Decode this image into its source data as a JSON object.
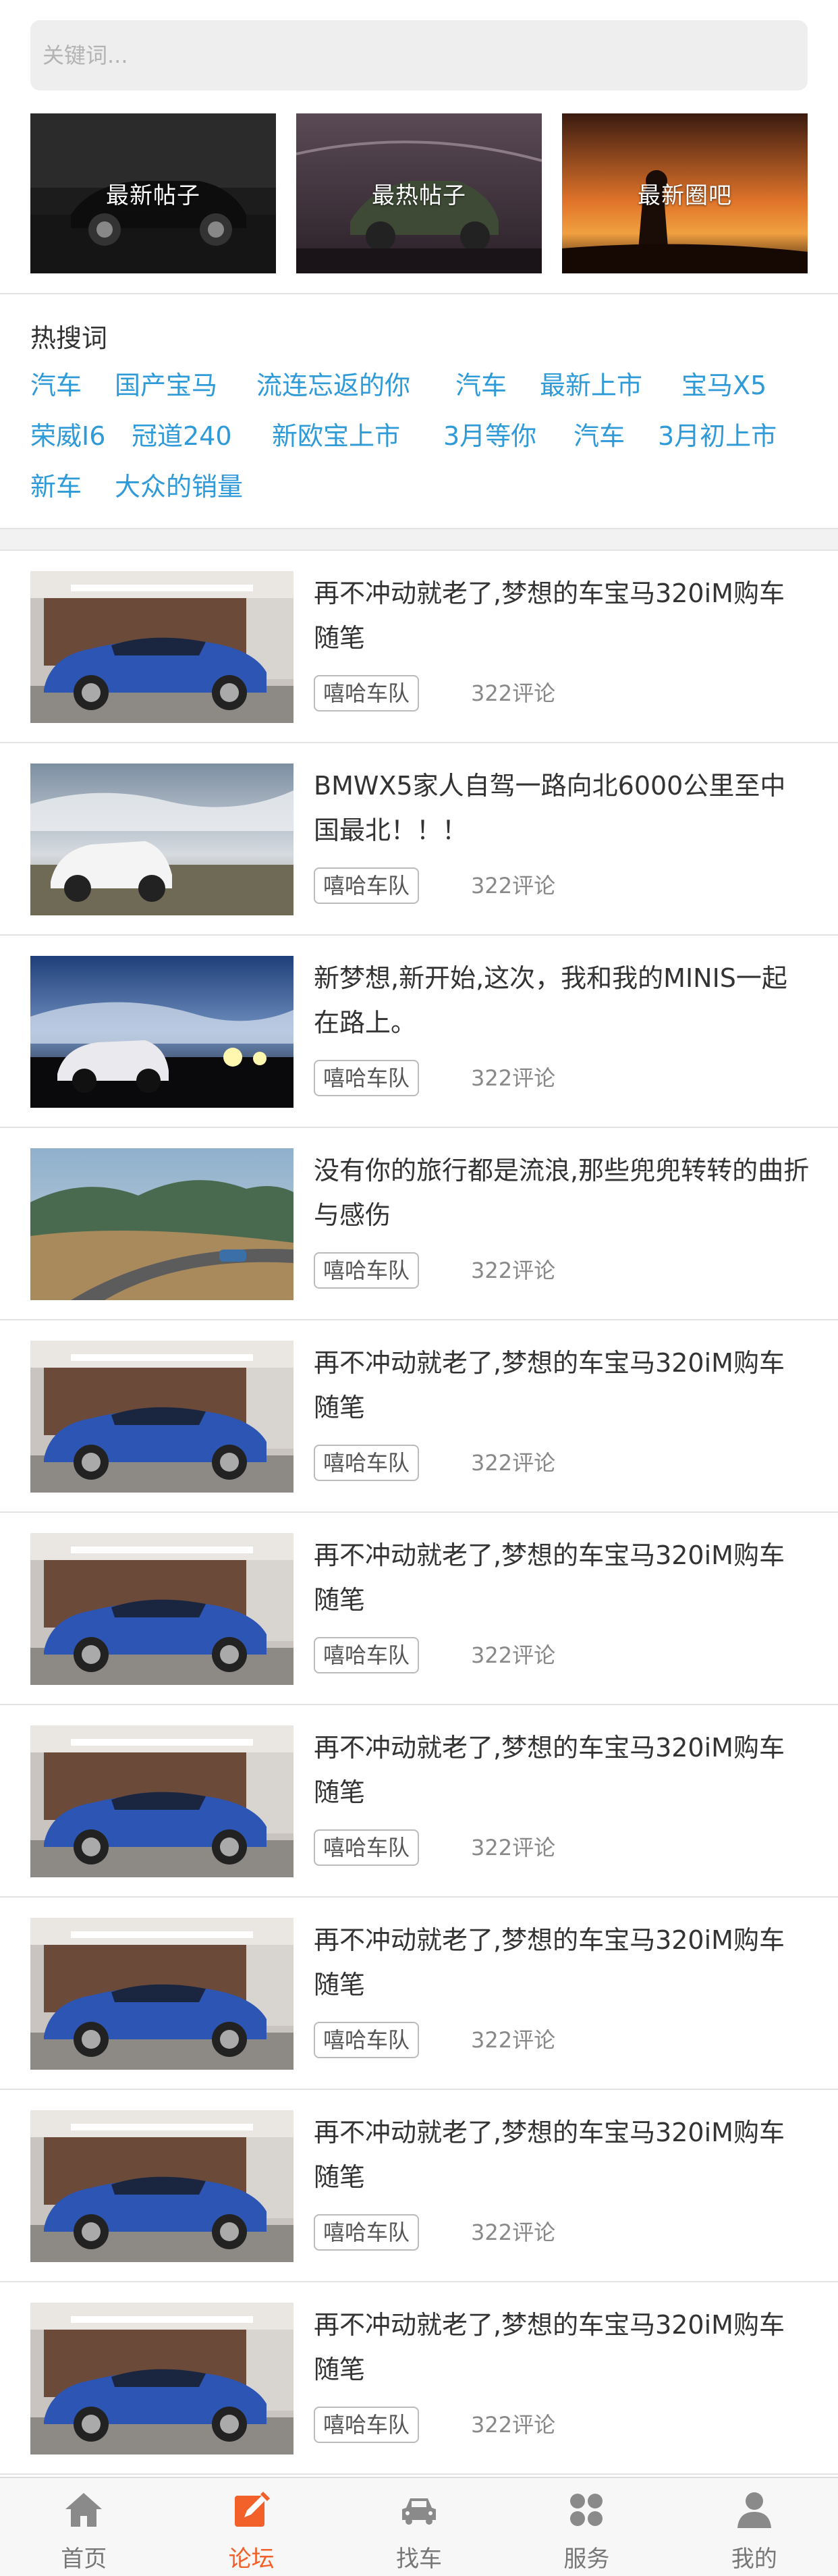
{
  "search": {
    "placeholder": "关键词..."
  },
  "categories": [
    {
      "label": "最新帖子"
    },
    {
      "label": "最热帖子"
    },
    {
      "label": "最新圈吧"
    }
  ],
  "hot": {
    "title": "热搜词",
    "tags": [
      "汽车",
      "国产宝马",
      "流连忘返的你",
      "汽车",
      "最新上市",
      "宝马X5",
      "荣威I6",
      "冠道240",
      "新欧宝上市",
      "3月等你",
      "汽车",
      "3月初上市",
      "新车",
      "大众的销量"
    ]
  },
  "posts": [
    {
      "title": "再不冲动就老了,梦想的车宝马320iM购车随笔",
      "badge": "嘻哈车队",
      "comments": "322评论"
    },
    {
      "title": "BMWX5家人自驾一路向北6000公里至中国最北！！！",
      "badge": "嘻哈车队",
      "comments": "322评论"
    },
    {
      "title": "新梦想,新开始,这次，我和我的MINIS一起在路上。",
      "badge": "嘻哈车队",
      "comments": "322评论"
    },
    {
      "title": "没有你的旅行都是流浪,那些兜兜转转的曲折与感伤",
      "badge": "嘻哈车队",
      "comments": "322评论"
    },
    {
      "title": "再不冲动就老了,梦想的车宝马320iM购车随笔",
      "badge": "嘻哈车队",
      "comments": "322评论"
    },
    {
      "title": "再不冲动就老了,梦想的车宝马320iM购车随笔",
      "badge": "嘻哈车队",
      "comments": "322评论"
    },
    {
      "title": "再不冲动就老了,梦想的车宝马320iM购车随笔",
      "badge": "嘻哈车队",
      "comments": "322评论"
    },
    {
      "title": "再不冲动就老了,梦想的车宝马320iM购车随笔",
      "badge": "嘻哈车队",
      "comments": "322评论"
    },
    {
      "title": "再不冲动就老了,梦想的车宝马320iM购车随笔",
      "badge": "嘻哈车队",
      "comments": "322评论"
    },
    {
      "title": "再不冲动就老了,梦想的车宝马320iM购车随笔",
      "badge": "嘻哈车队",
      "comments": "322评论"
    }
  ],
  "tabbar": {
    "items": [
      {
        "label": "首页",
        "icon": "home-icon"
      },
      {
        "label": "论坛",
        "icon": "forum-edit-icon"
      },
      {
        "label": "找车",
        "icon": "car-icon"
      },
      {
        "label": "服务",
        "icon": "service-grid-icon"
      },
      {
        "label": "我的",
        "icon": "user-icon"
      }
    ],
    "active_index": 1
  },
  "colors": {
    "accent": "#f2612a",
    "link": "#2f9ad8"
  }
}
